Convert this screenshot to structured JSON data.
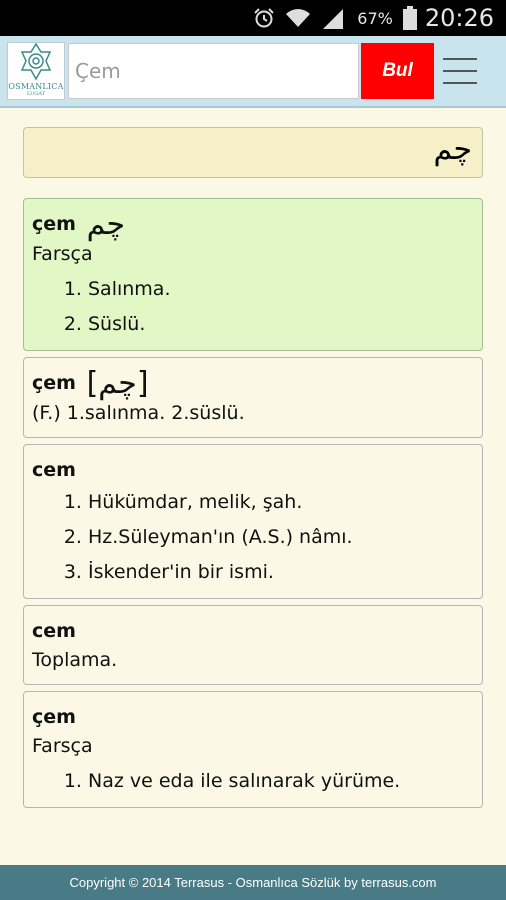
{
  "status": {
    "battery_pct": "67%",
    "time": "20:26"
  },
  "header": {
    "logo_text": "OSMANLICA",
    "logo_sub": "LUGAT",
    "search_value": "Çem",
    "search_button": "Bul"
  },
  "ottoman_input": "چم",
  "entries": [
    {
      "term": "çem",
      "arabic": "چم",
      "origin": "Farsça",
      "meanings": [
        "Salınma.",
        "Süslü."
      ]
    },
    {
      "term": "çem",
      "arabic": "[چم]",
      "text": "(F.) 1.salınma. 2.süslü."
    },
    {
      "term": "cem",
      "meanings": [
        "Hükümdar, melik, şah.",
        "Hz.Süleyman'ın (A.S.) nâmı.",
        "İskender'in bir ismi."
      ]
    },
    {
      "term": "cem",
      "text": "Toplama."
    },
    {
      "term": "çem",
      "origin": "Farsça",
      "meanings": [
        "Naz ve eda ile salınarak yürüme."
      ]
    }
  ],
  "footer": "Copyright © 2014 Terrasus - Osmanlıca Sözlük by terrasus.com"
}
